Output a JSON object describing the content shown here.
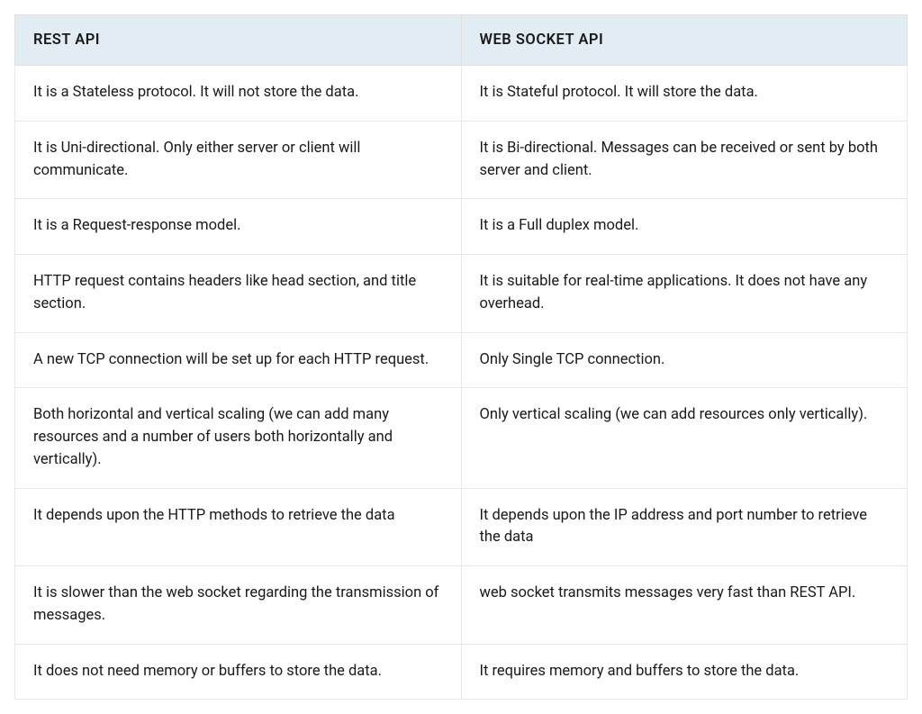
{
  "table": {
    "headers": {
      "col1": "REST API",
      "col2": "WEB SOCKET API"
    },
    "rows": [
      {
        "col1": "It is a Stateless protocol. It will not store the data.",
        "col2": "It is Stateful protocol. It will store the data."
      },
      {
        "col1": "It is Uni-directional. Only either server or client will communicate.",
        "col2": "It is Bi-directional. Messages can be received or sent by both server and client."
      },
      {
        "col1": "It is a Request-response model.",
        "col2": "It is a Full duplex model."
      },
      {
        "col1": "HTTP request contains headers like head section, and title section.",
        "col2": "It is suitable for real-time applications. It does not have any overhead."
      },
      {
        "col1": "A new TCP connection will be set up for each HTTP request.",
        "col2": "Only Single TCP connection."
      },
      {
        "col1": "Both horizontal and vertical scaling (we can add many resources and a number of users both horizontally and vertically).",
        "col2": "Only vertical scaling (we can add resources only vertically)."
      },
      {
        "col1": "It depends upon the HTTP methods to retrieve the data",
        "col2": "It depends upon the IP address and port number to retrieve the data"
      },
      {
        "col1": "It is slower than the web socket regarding the transmission of messages.",
        "col2": "web socket transmits messages very fast than REST API."
      },
      {
        "col1": "It does not need memory or buffers to store the data.",
        "col2": "It requires memory and buffers to store the data."
      }
    ]
  }
}
